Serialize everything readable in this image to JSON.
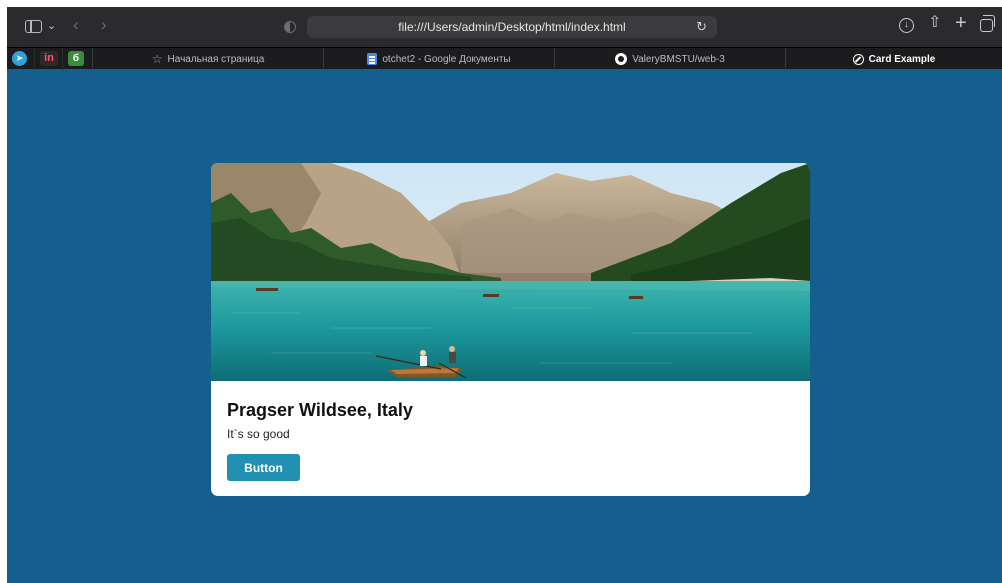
{
  "browser": {
    "address": "file:///Users/admin/Desktop/html/index.html",
    "icons": {
      "sidebar": "sidebar-icon",
      "back": "chevron-left-icon",
      "forward": "chevron-right-icon",
      "reload": "reload-icon",
      "download": "download-icon",
      "share": "share-icon",
      "new_tab": "plus-icon",
      "tab_overview": "tabs-icon"
    },
    "pinned_tabs": [
      {
        "icon": "telegram-icon",
        "glyph": "➤"
      },
      {
        "icon": "invision-icon",
        "glyph": "in"
      },
      {
        "icon": "grammar-icon",
        "glyph": "б"
      }
    ],
    "tabs": [
      {
        "label": "Начальная страница",
        "icon": "star-icon",
        "active": false
      },
      {
        "label": "otchet2 - Google Документы",
        "icon": "google-docs-icon",
        "active": false
      },
      {
        "label": "ValeryBMSTU/web-3",
        "icon": "github-icon",
        "active": false
      },
      {
        "label": "Card Example",
        "icon": "compass-icon",
        "active": true
      }
    ]
  },
  "page": {
    "background": "#145f8d",
    "card": {
      "image": "lake-mountains-photo",
      "title": "Pragser Wildsee, Italy",
      "text": "It`s so good",
      "button_label": "Button",
      "button_color": "#2190b3"
    }
  }
}
